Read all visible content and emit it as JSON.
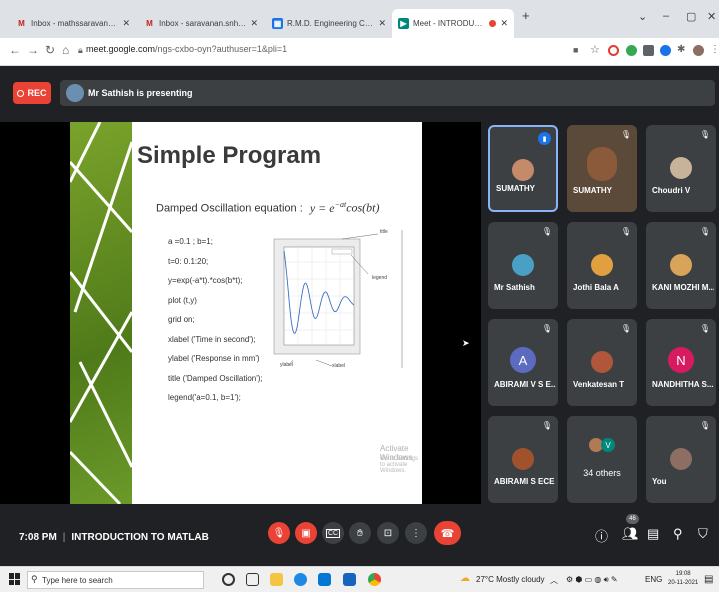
{
  "browser": {
    "tabs": [
      {
        "title": "Inbox - mathssaravanan77@gm",
        "favicon": "gmail-icon",
        "color": "#c5221f"
      },
      {
        "title": "Inbox - saravanan.snh@rmd.ac.in",
        "favicon": "gmail-icon",
        "color": "#c5221f"
      },
      {
        "title": "R.M.D. Engineering College - Cal",
        "favicon": "calendar-icon",
        "color": "#1a73e8"
      },
      {
        "title": "Meet - INTRODUCTION TO",
        "favicon": "meet-icon",
        "color": "#00897b"
      }
    ],
    "new_tab": "+",
    "url_host": "meet.google.com",
    "url_path": "/ngs-cxbo-oyn?authuser=1&pli=1"
  },
  "meeting": {
    "rec_label": "REC",
    "presenting_text": "Mr Sathish is presenting",
    "time": "7:08 PM",
    "title": "INTRODUCTION TO MATLAB",
    "participant_badge": "46"
  },
  "slide": {
    "title": "Simple Program",
    "equation_label": "Damped Oscillation equation :",
    "equation": "y = e",
    "equation_exp": "−at",
    "equation_tail": "cos(bt)",
    "code": [
      "a =0.1 ; b=1;",
      "t=0: 0.1:20;",
      "y=exp(-a*t).*cos(b*t);",
      "plot (t,y)",
      "grid on;",
      "xlabel ('Time in second');",
      "ylabel ('Response in mm')",
      "title ('Damped Oscillation');",
      "legend('a=0.1, b=1');"
    ],
    "callouts": {
      "title": "title",
      "legend": "legend",
      "ylabel": "ylabel",
      "xlabel": "xlabel"
    },
    "watermark_line1": "Activate Windows",
    "watermark_line2": "Go to Settings to activate Windows."
  },
  "participants": [
    {
      "name": "SUMATHY",
      "kind": "photo",
      "speaking": true,
      "muted": false
    },
    {
      "name": "SUMATHY",
      "kind": "video",
      "speaking": false,
      "muted": true
    },
    {
      "name": "Choudri V",
      "kind": "photo",
      "speaking": false,
      "muted": true
    },
    {
      "name": "Mr Sathish",
      "kind": "photo",
      "speaking": false,
      "muted": true
    },
    {
      "name": "Jothi Bala A",
      "kind": "photo",
      "speaking": false,
      "muted": true
    },
    {
      "name": "KANI MOZHI M...",
      "kind": "photo",
      "speaking": false,
      "muted": true
    },
    {
      "name": "ABIRAMI V S E...",
      "kind": "letter",
      "letter": "A",
      "color": "#5c6bc0",
      "muted": true
    },
    {
      "name": "Venkatesan T",
      "kind": "photo",
      "speaking": false,
      "muted": true
    },
    {
      "name": "NANDHITHA S...",
      "kind": "letter",
      "letter": "N",
      "color": "#d81b60",
      "muted": true
    },
    {
      "name": "ABIRAMI S ECE ...",
      "kind": "photo",
      "speaking": false,
      "muted": true
    },
    {
      "name": "34 others",
      "kind": "group",
      "letter": "V",
      "color": "#00897b",
      "muted": false
    },
    {
      "name": "You",
      "kind": "photo",
      "speaking": false,
      "muted": true
    }
  ],
  "taskbar": {
    "search_placeholder": "Type here to search",
    "weather": "27°C  Mostly cloudy",
    "language": "ENG",
    "clock_time": "19:08",
    "clock_date": "20-11-2021"
  },
  "colors": {
    "accent": "#8ab4f8",
    "danger": "#ea4335",
    "meet_bg": "#202124",
    "tile_bg": "#3c4043"
  }
}
